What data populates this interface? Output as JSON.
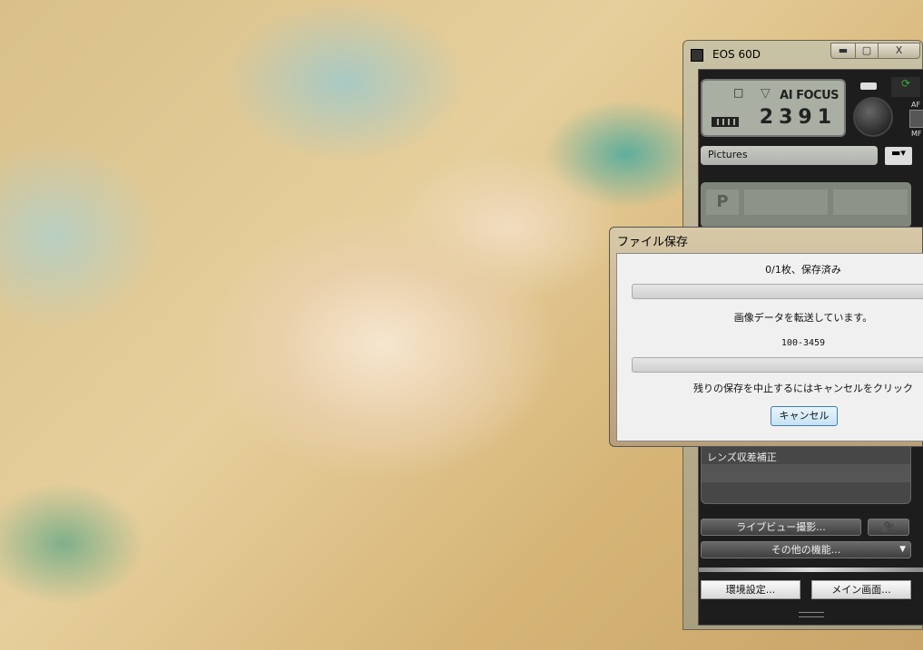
{
  "eos_window": {
    "title": "EOS 60D",
    "controls": {
      "minimize": "▬",
      "maximize": "▢",
      "close": "X"
    },
    "lcd": {
      "af_mode": "AI FOCUS",
      "shots_remaining": "2391",
      "drive_icon": "□"
    },
    "af_label": "AF",
    "mf_label": "MF",
    "destination_folder": "Pictures",
    "folder_button_icon": "folder-icon",
    "shooting_mode": "P",
    "lens_list_item": "レンズ収差補正",
    "live_view_button": "ライブビュー撮影...",
    "movie_button_icon": "movie-camera-icon",
    "other_functions_button": "その他の機能...",
    "preferences_button": "環境設定...",
    "main_window_button": "メイン画面..."
  },
  "save_dialog": {
    "title": "ファイル保存",
    "count_status": "0/1枚、保存済み",
    "overall_progress": 0,
    "transfer_status": "画像データを転送しています。",
    "file_name": "100-3459",
    "file_progress": 0,
    "instruction": "残りの保存を中止するにはキャンセルをクリック",
    "cancel_button": "キャンセル"
  }
}
